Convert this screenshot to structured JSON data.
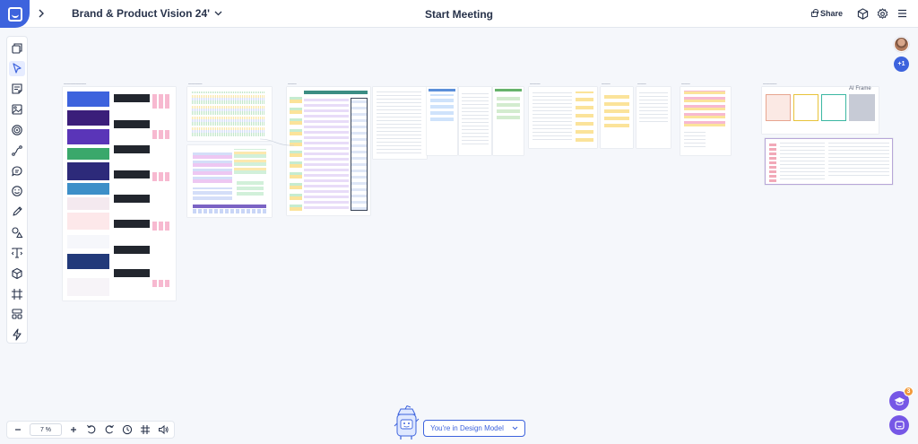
{
  "header": {
    "board_title": "Brand & Product Vision 24'",
    "center_action": "Start Meeting",
    "share_label": "Share"
  },
  "collaborators": {
    "extra_count": "+1"
  },
  "canvas": {
    "frame_label_ai": "AI Frame"
  },
  "zoom": {
    "value": "7 %"
  },
  "mode": {
    "label": "You're in Design Model"
  },
  "notifications": {
    "help_count": "3"
  },
  "colors": {
    "accent": "#3d63dd",
    "purple": "#7657e6",
    "badge": "#f29a3a"
  },
  "icons": {
    "tools": [
      "layers-icon",
      "cursor-icon",
      "sticky-note-icon",
      "image-icon",
      "target-icon",
      "connector-icon",
      "comment-icon",
      "emoji-icon",
      "pen-icon",
      "shapes-icon",
      "text-icon",
      "cube-icon",
      "frame-icon",
      "template-icon",
      "lightning-icon"
    ]
  }
}
